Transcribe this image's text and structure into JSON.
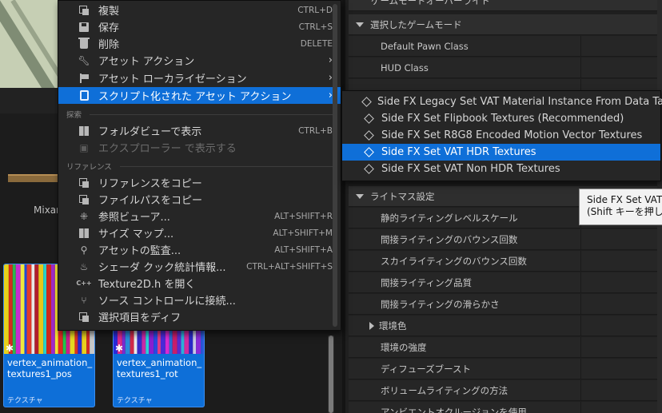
{
  "content_browser": {
    "folder_label": "Mixar",
    "assets": [
      {
        "name_line1": "vertex_animation_",
        "name_line2": "textures1_pos",
        "type": "テクスチャ"
      },
      {
        "name_line1": "vertex_animation_",
        "name_line2": "textures1_rot",
        "type": "テクスチャ"
      }
    ]
  },
  "details_panel": {
    "rows": [
      {
        "label": "ゲームモードオーバーライド",
        "kind": "header-partial"
      },
      {
        "label": "選択したゲームモード",
        "kind": "header"
      },
      {
        "label": "Default Pawn Class",
        "kind": "prop"
      },
      {
        "label": "HUD Class",
        "kind": "prop"
      },
      {
        "label": "ライトマス設定",
        "kind": "header"
      },
      {
        "label": "静的ライティングレベルスケール",
        "kind": "prop"
      },
      {
        "label": "間接ライティングのバウンス回数",
        "kind": "prop"
      },
      {
        "label": "スカイライティングのバウンス回数",
        "kind": "prop"
      },
      {
        "label": "間接ライティング品質",
        "kind": "prop"
      },
      {
        "label": "間接ライティングの滑らかさ",
        "kind": "prop"
      },
      {
        "label": "環境色",
        "kind": "expandable"
      },
      {
        "label": "環境の強度",
        "kind": "prop"
      },
      {
        "label": "ディフューズブースト",
        "kind": "prop"
      },
      {
        "label": "ボリュームライティングの方法",
        "kind": "prop"
      },
      {
        "label": "アンビエントオクルージョンを使用",
        "kind": "prop"
      }
    ]
  },
  "context_menu": {
    "items": [
      {
        "label": "複製",
        "shortcut": "CTRL+D",
        "icon": "duplicate-icon"
      },
      {
        "label": "保存",
        "shortcut": "CTRL+S",
        "icon": "save-icon"
      },
      {
        "label": "削除",
        "shortcut": "DELETE",
        "icon": "delete-icon"
      },
      {
        "label": "アセット アクション",
        "shortcut": "",
        "icon": "wrench-icon",
        "submenu": true
      },
      {
        "label": "アセット ローカライゼーション",
        "shortcut": "",
        "icon": "flag-icon",
        "submenu": true
      },
      {
        "label": "スクリプト化された アセット アクション",
        "shortcut": "",
        "icon": "script-icon",
        "submenu": true,
        "highlighted": true
      }
    ],
    "section_explore": "探索",
    "explore_items": [
      {
        "label": "フォルダビューで表示",
        "shortcut": "CTRL+B",
        "icon": "folder-view-icon"
      },
      {
        "label": "エクスプローラー で表示する",
        "shortcut": "",
        "icon": "explorer-icon",
        "disabled": true
      }
    ],
    "section_reference": "リファレンス",
    "reference_items": [
      {
        "label": "リファレンスをコピー",
        "shortcut": "",
        "icon": "copy-reference-icon"
      },
      {
        "label": "ファイルパスをコピー",
        "shortcut": "",
        "icon": "copy-path-icon"
      },
      {
        "label": "参照ビューア...",
        "shortcut": "ALT+SHIFT+R",
        "icon": "reference-viewer-icon"
      },
      {
        "label": "サイズ マップ...",
        "shortcut": "ALT+SHIFT+M",
        "icon": "size-map-icon"
      },
      {
        "label": "アセットの監査...",
        "shortcut": "ALT+SHIFT+A",
        "icon": "audit-icon"
      },
      {
        "label": "シェーダ クック統計情報...",
        "shortcut": "CTRL+ALT+SHIFT+S",
        "icon": "shader-icon"
      },
      {
        "label": "Texture2D.h を開く",
        "shortcut": "",
        "icon": "cpp-icon"
      },
      {
        "label": "ソース コントロールに接続...",
        "shortcut": "",
        "icon": "source-control-icon"
      },
      {
        "label": "選択項目をディフ",
        "shortcut": "",
        "icon": "diff-icon"
      }
    ],
    "submenu_chevron": "›"
  },
  "sub_menu": {
    "items": [
      {
        "label": "Side FX Legacy Set VAT Material Instance From Data Table"
      },
      {
        "label": "Side FX Set Flipbook Textures (Recommended)"
      },
      {
        "label": "Side FX Set R8G8 Encoded Motion Vector Textures"
      },
      {
        "label": "Side FX Set VAT HDR Textures",
        "highlighted": true
      },
      {
        "label": "Side FX Set VAT Non HDR Textures"
      }
    ]
  },
  "tooltip": {
    "line1": "Side FX Set VAT H",
    "line2": "(Shift キーを押しな"
  },
  "colors": {
    "highlight": "#0f6fd8",
    "menu_bg": "#262626",
    "panel_bg": "#1f1f1f"
  }
}
